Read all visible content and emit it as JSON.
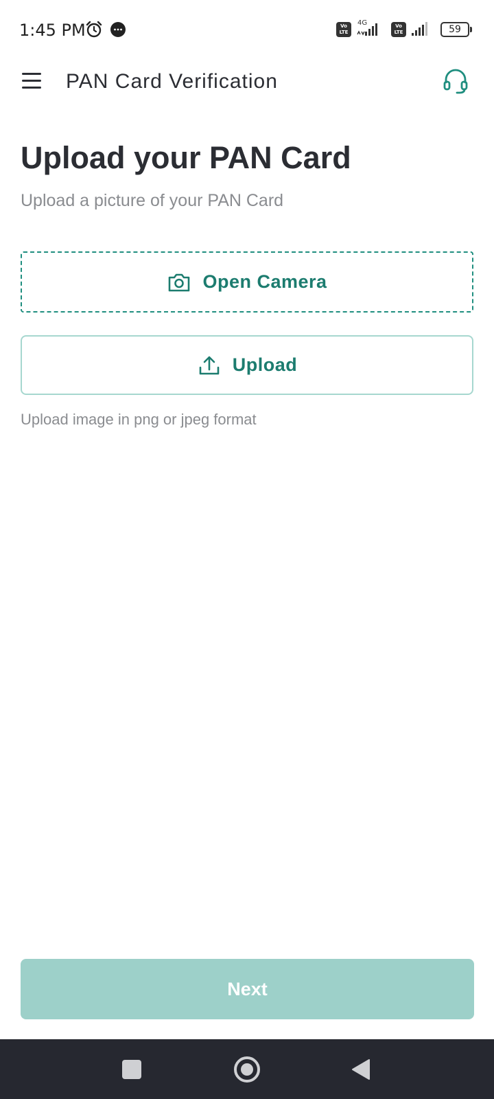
{
  "status_bar": {
    "time": "1:45 PM",
    "network_label": "4G",
    "volte_label": "Vo LTE",
    "battery_level": "59",
    "icons": [
      "alarm-icon",
      "message-icon",
      "volte-icon",
      "signal-icon",
      "battery-icon"
    ]
  },
  "app_bar": {
    "title": "PAN Card Verification",
    "menu_icon": "hamburger-menu-icon",
    "support_icon": "headset-icon"
  },
  "main": {
    "heading": "Upload your PAN Card",
    "subtitle": "Upload a picture of your PAN Card",
    "camera_button_label": "Open Camera",
    "upload_button_label": "Upload",
    "format_hint": "Upload image in png or jpeg format"
  },
  "footer": {
    "next_label": "Next"
  },
  "nav_bar": {
    "icons": [
      "recents-icon",
      "home-icon",
      "back-icon"
    ]
  },
  "colors": {
    "accent": "#1c7c6f",
    "accent_border": "#1f8e7f",
    "next_button_disabled": "#9dd0c9",
    "nav_bar_bg": "#262830"
  }
}
